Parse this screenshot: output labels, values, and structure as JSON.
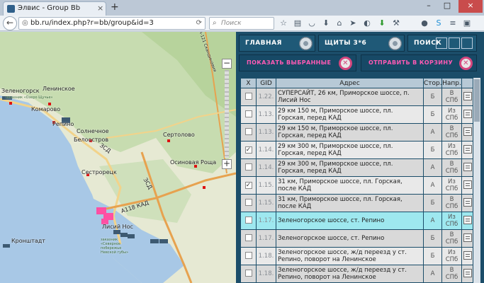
{
  "browser": {
    "tab_title": "Элвис - Group Bb",
    "close_glyph": "×",
    "new_tab_glyph": "+",
    "url": "bb.ru/index.php?r=bb/group&id=3",
    "search_placeholder": "Поиск",
    "minimize_glyph": "–",
    "maximize_glyph": "□",
    "window_close_glyph": "×"
  },
  "map": {
    "labels": [
      "Зеленогорск",
      "Ленинское",
      "Комарово",
      "Репино",
      "Солнечное",
      "Белоостров",
      "Сертолово",
      "Осиновая Роща",
      "Сестрорецк",
      "Лисий Нос",
      "Кронштадт",
      "заказник «Озеро Щучье»",
      "заказник «Северное побережье Невской губы»",
      "ЗСД",
      "А118 КАД",
      "A-121 Скандинавия",
      "ЗСД"
    ],
    "zoom_in": "+",
    "zoom_out": "−"
  },
  "panel": {
    "nav": {
      "main": "ГЛАВНАЯ",
      "boards": "ЩИТЫ 3*6",
      "search": "ПОИСК"
    },
    "actions": {
      "show_selected": "ПОКАЗАТЬ ВЫБРАННЫЕ",
      "send_to_cart": "ОТПРАВИТЬ В КОРЗИНУ"
    },
    "table": {
      "columns": [
        "X",
        "GID",
        "Адрес",
        "Стор.",
        "Напр.",
        ""
      ],
      "rows": [
        {
          "gid": "1.22.",
          "address": "СУПЕРСАЙТ, 26 км, Приморское шоссе, п. Лисий Нос",
          "side": "Б",
          "dir": "В СПб",
          "checked": false
        },
        {
          "gid": "1.13.",
          "address": "29 км 150 м, Приморское шоссе, пл. Горская, перед КАД",
          "side": "Б",
          "dir": "Из СПб",
          "checked": false
        },
        {
          "gid": "1.13.",
          "address": "29 км 150 м, Приморское шоссе, пл. Горская, перед КАД",
          "side": "А",
          "dir": "В СПб",
          "checked": false
        },
        {
          "gid": "1.14.",
          "address": "29 км 300 м, Приморское шоссе, пл. Горская, перед КАД",
          "side": "Б",
          "dir": "Из СПб",
          "checked": true
        },
        {
          "gid": "1.14.",
          "address": "29 км 300 м, Приморское шоссе, пл. Горская, перед КАД",
          "side": "А",
          "dir": "В СПб",
          "checked": false
        },
        {
          "gid": "1.15.",
          "address": "31 км, Приморское шоссе, пл. Горская, после КАД",
          "side": "А",
          "dir": "Из СПб",
          "checked": true
        },
        {
          "gid": "1.15.",
          "address": "31 км, Приморское шоссе, пл. Горская, после КАД",
          "side": "Б",
          "dir": "В СПб",
          "checked": false
        },
        {
          "gid": "1.17.",
          "address": "Зеленогорское шоссе, ст. Репино",
          "side": "А",
          "dir": "Из СПб",
          "checked": false,
          "highlight": true
        },
        {
          "gid": "1.17.",
          "address": "Зеленогорское шоссе, ст. Репино",
          "side": "Б",
          "dir": "В СПб",
          "checked": false
        },
        {
          "gid": "1.18.",
          "address": "Зеленогорское шоссе, ж/д переезд у ст. Репино, поворот на Ленинское",
          "side": "Б",
          "dir": "Из СПб",
          "checked": false
        },
        {
          "gid": "1.18.",
          "address": "Зеленогорское шоссе, ж/д переезд у ст. Репино, поворот на Ленинское",
          "side": "А",
          "dir": "В СПб",
          "checked": false
        }
      ]
    }
  },
  "colors": {
    "panel_bg": "#1b4d69",
    "accent_pink": "#ff5ab4",
    "highlight_row": "#9ee8ef"
  }
}
